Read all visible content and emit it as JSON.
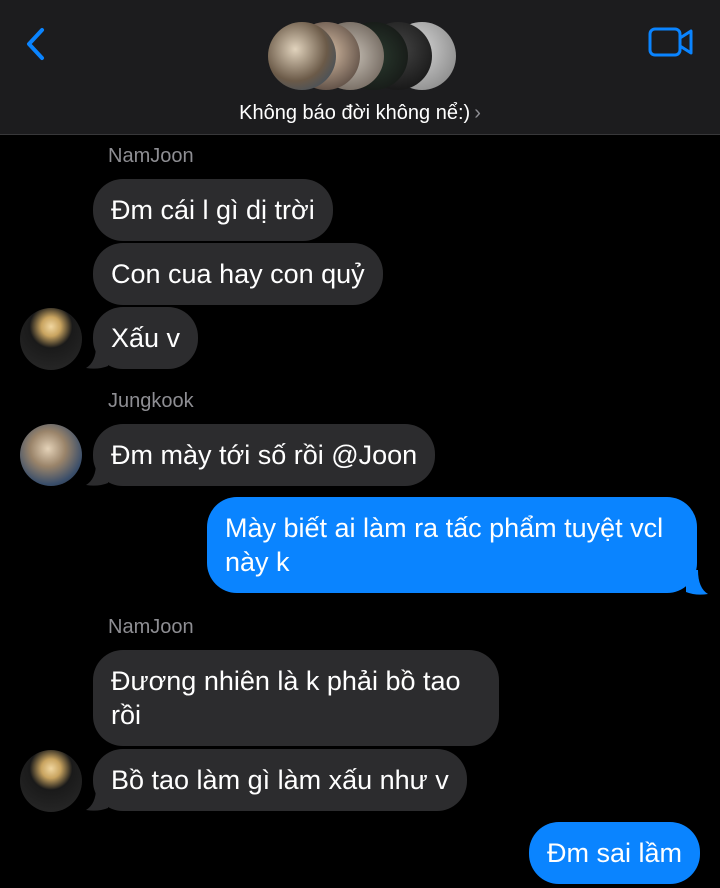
{
  "header": {
    "group_name": "Không báo đời không nể:)",
    "chevron": "›",
    "back_icon": "chevron-left-icon",
    "video_icon": "video-camera-icon",
    "accent_color": "#0a84ff"
  },
  "messages": [
    {
      "sender": "NamJoon"
    },
    {
      "text": "Đm cái l gì dị trời"
    },
    {
      "text": "Con cua hay con quỷ"
    },
    {
      "text": "Xấu v"
    },
    {
      "sender": "Jungkook"
    },
    {
      "text": "Đm mày tới số rồi @Joon"
    },
    {
      "text": "Mày biết ai làm ra tấc phẩm tuyệt vcl này k"
    },
    {
      "sender": "NamJoon"
    },
    {
      "text": "Đương nhiên là k phải bồ tao rồi"
    },
    {
      "text": "Bồ tao làm gì làm xấu như v"
    },
    {
      "text": "Đm sai lầm"
    }
  ],
  "colors": {
    "incoming_bubble": "#2c2c2e",
    "outgoing_bubble": "#0a84ff",
    "background": "#000000",
    "header_bg": "#1c1c1e"
  }
}
